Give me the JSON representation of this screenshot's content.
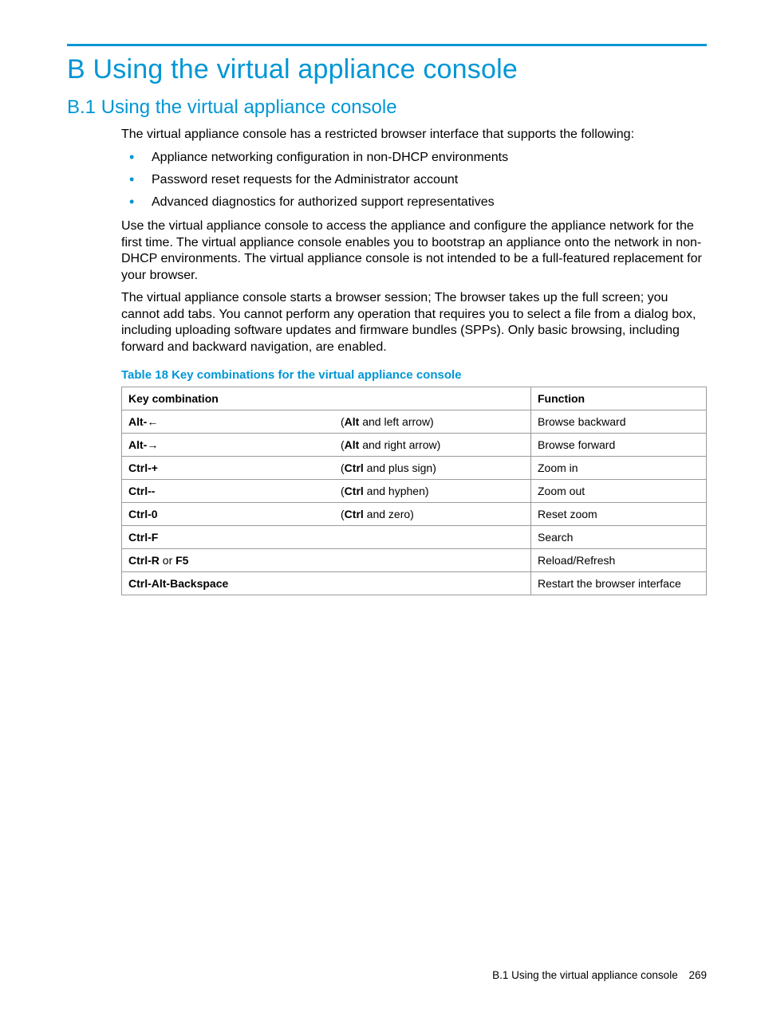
{
  "heading1": "B Using the virtual appliance console",
  "heading2": "B.1 Using the virtual appliance console",
  "intro": "The virtual appliance console has a restricted browser interface that supports the following:",
  "bullets": [
    "Appliance networking configuration in non-DHCP environments",
    "Password reset requests for the Administrator account",
    "Advanced diagnostics for authorized support representatives"
  ],
  "para2": "Use the virtual appliance console to access the appliance and configure the appliance network for the first time. The virtual appliance console enables you to bootstrap an appliance onto the network in non-DHCP environments. The virtual appliance console is not intended to be a full-featured replacement for your browser.",
  "para3": "The virtual appliance console starts a browser session; The browser takes up the full screen; you cannot add tabs. You cannot perform any operation that requires you to select a file from a dialog box, including uploading software updates and firmware bundles (SPPs). Only basic browsing, including forward and backward navigation, are enabled.",
  "tableCaption": "Table 18 Key combinations for the virtual appliance console",
  "tableHeaders": {
    "c1": "Key combination",
    "c2": "Function"
  },
  "rows": [
    {
      "key": "Alt-←",
      "hintBold": "Alt",
      "hintRest": " and left arrow)",
      "func": "Browse backward"
    },
    {
      "key": "Alt-→",
      "hintBold": "Alt",
      "hintRest": " and right arrow)",
      "func": "Browse forward"
    },
    {
      "key": "Ctrl-+",
      "hintBold": "Ctrl",
      "hintRest": " and plus sign)",
      "func": "Zoom in"
    },
    {
      "key": "Ctrl--",
      "hintBold": "Ctrl",
      "hintRest": " and hyphen)",
      "func": "Zoom out"
    },
    {
      "key": "Ctrl-0",
      "hintBold": "Ctrl",
      "hintRest": " and zero)",
      "func": "Reset zoom"
    },
    {
      "key": "Ctrl-F",
      "hintBold": "",
      "hintRest": "",
      "func": "Search"
    },
    {
      "keyHtml": true,
      "keyParts": [
        "Ctrl-R",
        " or ",
        "F5"
      ],
      "hintBold": "",
      "hintRest": "",
      "func": "Reload/Refresh"
    },
    {
      "key": "Ctrl-Alt-Backspace",
      "hintBold": "",
      "hintRest": "",
      "func": "Restart the browser interface"
    }
  ],
  "footer": {
    "text": "B.1 Using the virtual appliance console",
    "page": "269"
  }
}
